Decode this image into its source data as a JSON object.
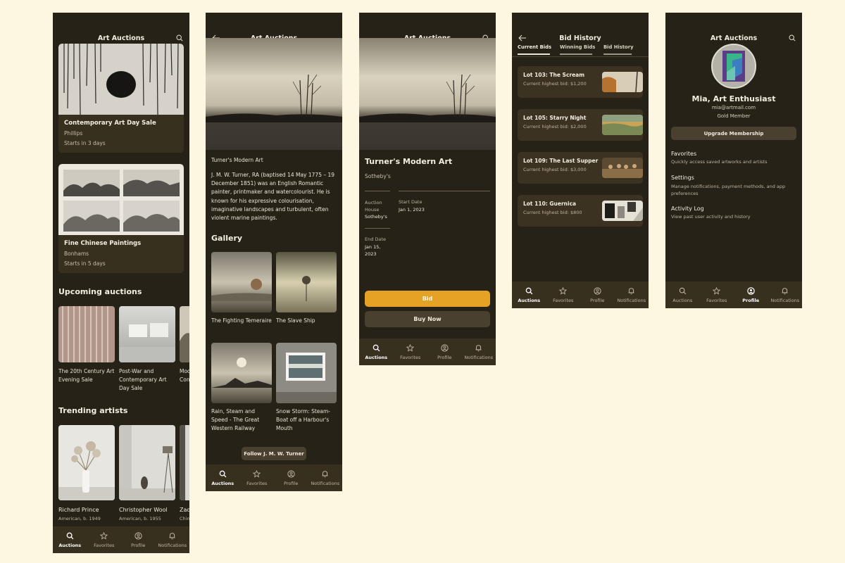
{
  "colors": {
    "background": "#fdf6e1",
    "screen": "#272218",
    "card": "#38301f",
    "accent": "#e5a225",
    "muted_button": "#4a4030"
  },
  "nav": {
    "auctions": "Auctions",
    "favorites": "Favorites",
    "profile": "Profile",
    "notifications": "Notifications"
  },
  "screen1": {
    "title": "Art Auctions",
    "featured": [
      {
        "title": "Contemporary Art Day Sale",
        "house": "Phillips",
        "starts": "Starts in 3 days"
      },
      {
        "title": "Fine Chinese Paintings",
        "house": "Bonhams",
        "starts": "Starts in 5 days"
      }
    ],
    "upcoming_heading": "Upcoming auctions",
    "upcoming": [
      {
        "title": "The 20th Century Art Evening Sale"
      },
      {
        "title": "Post-War and Contemporary Art Day Sale"
      },
      {
        "title": "Modern Contemporary Sou..."
      }
    ],
    "trending_heading": "Trending artists",
    "artists": [
      {
        "name": "Richard Prince",
        "info": "American, b. 1949"
      },
      {
        "name": "Christopher Wool",
        "info": "American, b. 1955"
      },
      {
        "name": "Zao...",
        "info": "Chin..."
      }
    ]
  },
  "screen2": {
    "title": "Art Auctions",
    "lot_title": "Turner's Modern Art",
    "bio": "J. M. W. Turner, RA (baptised 14 May 1775 – 19 December 1851) was an English Romantic painter, printmaker and watercolourist. He is known for his expressive colourisation, imaginative landscapes and turbulent, often violent marine paintings.",
    "gallery_heading": "Gallery",
    "gallery": [
      {
        "title": "The Fighting Temeraire"
      },
      {
        "title": "The Slave Ship"
      },
      {
        "title": "Rain, Steam and Speed - The Great Western Railway"
      },
      {
        "title": "Snow Storm: Steam-Boat off a Harbour's Mouth"
      }
    ],
    "follow_label": "Follow J. M. W. Turner"
  },
  "screen3": {
    "title": "Art Auctions",
    "lot_title": "Turner's Modern Art",
    "house_label": "Sotheby's",
    "auction_house_key": "Auction House",
    "auction_house_value": "Sotheby's",
    "start_date_key": "Start Date",
    "start_date_value": "Jan 1, 2023",
    "end_date_key": "End Date",
    "end_date_value": "Jan 15, 2023",
    "bid_label": "Bid",
    "buy_now_label": "Buy Now"
  },
  "screen4": {
    "title": "Bid History",
    "tabs": [
      "Current Bids",
      "Winning Bids",
      "Bid History"
    ],
    "bids": [
      {
        "lot": "Lot 103: The Scream",
        "bid": "Current highest bid: $1,200"
      },
      {
        "lot": "Lot 105: Starry Night",
        "bid": "Current highest bid: $2,000"
      },
      {
        "lot": "Lot 109: The Last Supper",
        "bid": "Current highest bid: $3,000"
      },
      {
        "lot": "Lot 110: Guernica",
        "bid": "Current highest bid: $800"
      }
    ]
  },
  "screen5": {
    "title": "Art Auctions",
    "name": "Mia, Art Enthusiast",
    "email": "mia@artmail.com",
    "tier": "Gold Member",
    "upgrade_label": "Upgrade Membership",
    "menu": [
      {
        "title": "Favorites",
        "desc": "Quickly access saved artworks and artists"
      },
      {
        "title": "Settings",
        "desc": "Manage notifications, payment methods, and app preferences"
      },
      {
        "title": "Activity Log",
        "desc": "View past user activity and history"
      }
    ]
  }
}
